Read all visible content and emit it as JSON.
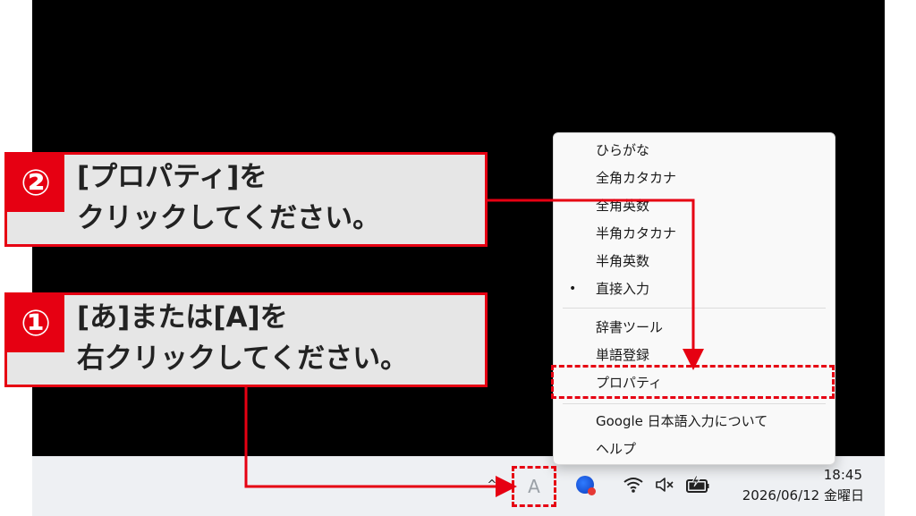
{
  "menu": {
    "items": [
      {
        "label": "ひらがな",
        "bullet": ""
      },
      {
        "label": "全角カタカナ",
        "bullet": ""
      },
      {
        "label": "全角英数",
        "bullet": ""
      },
      {
        "label": "半角カタカナ",
        "bullet": ""
      },
      {
        "label": "半角英数",
        "bullet": ""
      },
      {
        "label": "直接入力",
        "bullet": "•"
      }
    ],
    "tools": [
      {
        "label": "辞書ツール"
      },
      {
        "label": "単語登録"
      },
      {
        "label": "プロパティ"
      }
    ],
    "info": [
      {
        "label": "Google 日本語入力について"
      },
      {
        "label": "ヘルプ"
      }
    ]
  },
  "callouts": {
    "step2": {
      "number": "②",
      "line1": "[プロパティ]を",
      "line2": "クリックしてください。"
    },
    "step1": {
      "number": "①",
      "line1": "[あ]または[A]を",
      "line2": "右クリックしてください。"
    }
  },
  "taskbar": {
    "chevron": "^",
    "ime_glyph": "A",
    "time": "18:45",
    "date": "2026/06/12 金曜日",
    "icons": [
      "chevron-up-icon",
      "ime-mode-icon",
      "app-icon",
      "wifi-icon",
      "volume-mute-icon",
      "battery-charging-icon"
    ]
  },
  "colors": {
    "accent": "#e60012",
    "callout_bg": "#e6e6e6",
    "desktop": "#000000",
    "taskbar": "#eef0f3"
  }
}
